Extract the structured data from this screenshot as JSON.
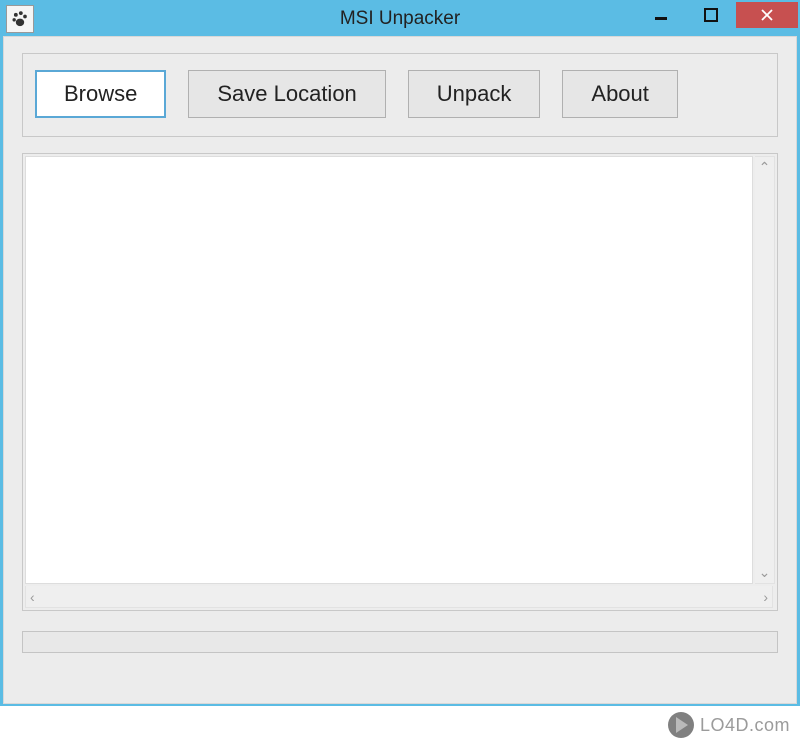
{
  "window": {
    "title": "MSI Unpacker"
  },
  "toolbar": {
    "browse_label": "Browse",
    "save_location_label": "Save Location",
    "unpack_label": "Unpack",
    "about_label": "About"
  },
  "content": {
    "text_value": ""
  },
  "watermark": {
    "text": "LO4D.com"
  }
}
